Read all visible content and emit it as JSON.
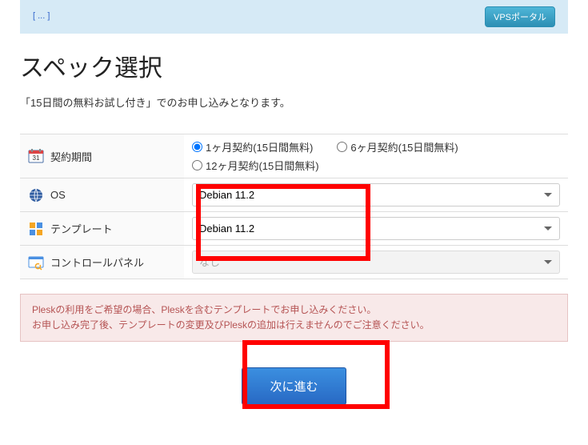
{
  "banner": {
    "link_text": "[ ... ]",
    "portal_btn": "VPSポータル"
  },
  "page_title": "スペック選択",
  "subtitle": "「15日間の無料お試し付き」でのお申し込みとなります。",
  "rows": {
    "period": {
      "label": "契約期間",
      "options": [
        "1ヶ月契約(15日間無料)",
        "6ヶ月契約(15日間無料)",
        "12ヶ月契約(15日間無料)"
      ],
      "selected": 0
    },
    "os": {
      "label": "OS",
      "value": "Debian 11.2"
    },
    "template": {
      "label": "テンプレート",
      "value": "Debian 11.2"
    },
    "cpanel": {
      "label": "コントロールパネル",
      "value": "なし"
    }
  },
  "alert": {
    "line1": "Pleskの利用をご希望の場合、Pleskを含むテンプレートでお申し込みください。",
    "line2": "お申し込み完了後、テンプレートの変更及びPleskの追加は行えませんのでご注意ください。"
  },
  "next_btn": "次に進む"
}
